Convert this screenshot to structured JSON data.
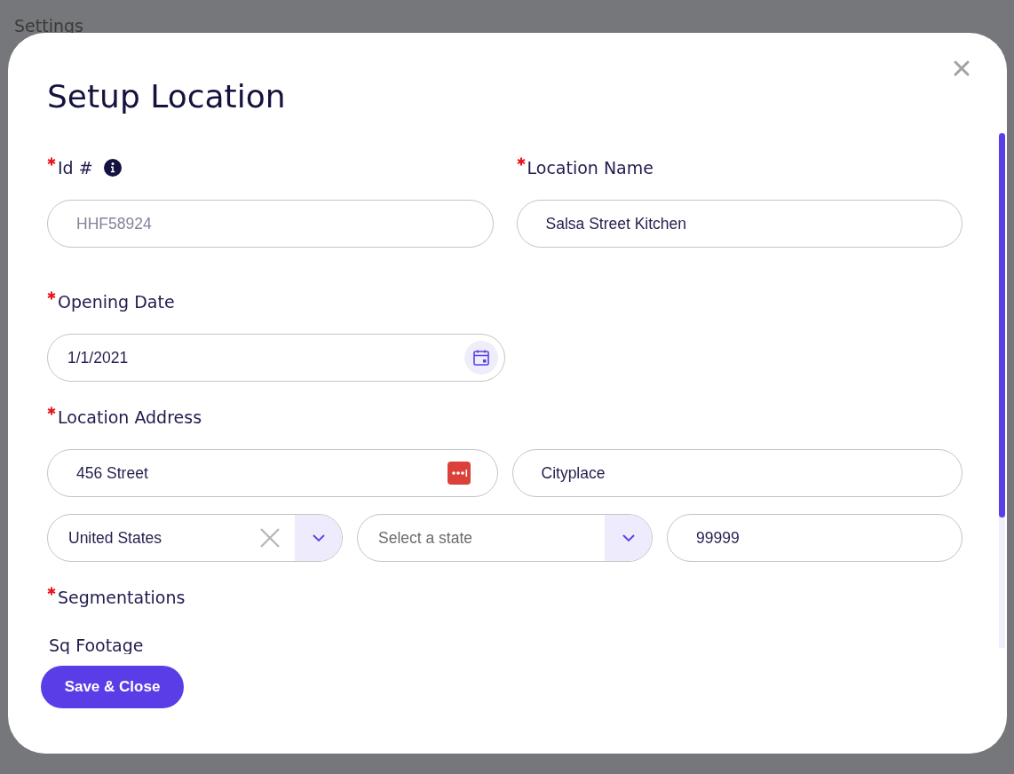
{
  "background": {
    "title": "Settings"
  },
  "dialog": {
    "title": "Setup Location",
    "rows": [
      {
        "sections": [
          {
            "label": "Id #",
            "required": true,
            "info": true,
            "lines": [
              [
                {
                  "kind": "text",
                  "placeholder": "HHF58924",
                  "autofill": false
                }
              ]
            ]
          },
          {
            "label": "Location Name",
            "required": true,
            "info": false,
            "lines": [
              [
                {
                  "kind": "text",
                  "value": "Salsa Street Kitchen",
                  "autofill": false
                }
              ]
            ]
          }
        ]
      },
      {
        "sections": [
          {
            "label": "Opening Date",
            "required": true,
            "info": false,
            "lines": [
              [
                {
                  "kind": "date",
                  "value": "1/1/2021"
                }
              ]
            ]
          }
        ]
      },
      {
        "sections": [
          {
            "label": "Location Address",
            "required": true,
            "info": false,
            "lines": [
              [
                {
                  "kind": "text",
                  "value": "456 Street",
                  "autofill": true
                },
                {
                  "kind": "text",
                  "value": "Cityplace",
                  "autofill": false
                }
              ],
              [
                {
                  "kind": "select",
                  "value": "United States",
                  "clearable": true
                },
                {
                  "kind": "select",
                  "placeholder": "Select a state",
                  "clearable": false
                },
                {
                  "kind": "text",
                  "value": "99999",
                  "autofill": false
                }
              ]
            ]
          }
        ]
      },
      {
        "sections": [
          {
            "label": "Segmentations",
            "required": true,
            "info": false
          }
        ]
      },
      {
        "sections": [
          {
            "label": "Sq Footage",
            "required": false,
            "info": false
          }
        ]
      }
    ],
    "save_button": "Save & Close"
  }
}
